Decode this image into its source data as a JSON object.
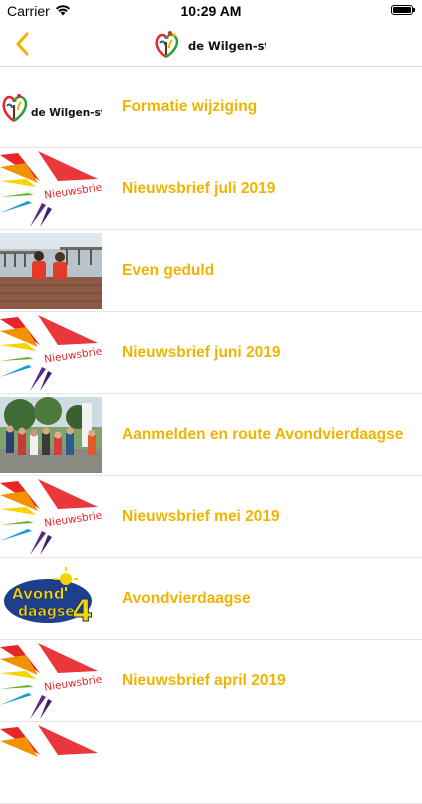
{
  "status_bar": {
    "carrier": "Carrier",
    "time": "10:29 AM"
  },
  "nav": {
    "logo_text": "de Wilgen-stam"
  },
  "thumb_texts": {
    "logo": "de Wilgen-stam",
    "newsletter": "Nieuwsbrief",
    "avond_line1": "Avond",
    "avond_line2": "daagse",
    "avond_number": "4"
  },
  "items": [
    {
      "title": "Formatie wijziging",
      "thumbnail": "wilgenstam-logo"
    },
    {
      "title": "Nieuwsbrief juli 2019",
      "thumbnail": "nieuwsbrief-rainbow"
    },
    {
      "title": "Even geduld",
      "thumbnail": "photo-pier-children"
    },
    {
      "title": "Nieuwsbrief juni 2019",
      "thumbnail": "nieuwsbrief-rainbow"
    },
    {
      "title": "Aanmelden en route Avondvierdaagse",
      "thumbnail": "photo-crowd"
    },
    {
      "title": "Nieuwsbrief mei 2019",
      "thumbnail": "nieuwsbrief-rainbow"
    },
    {
      "title": "Avondvierdaagse",
      "thumbnail": "avondvierdaagse-logo"
    },
    {
      "title": "Nieuwsbrief april 2019",
      "thumbnail": "nieuwsbrief-rainbow"
    },
    {
      "title": "",
      "thumbnail": "nieuwsbrief-rainbow"
    }
  ],
  "colors": {
    "accent": "#f0b400",
    "divider": "#e6e6e6"
  }
}
